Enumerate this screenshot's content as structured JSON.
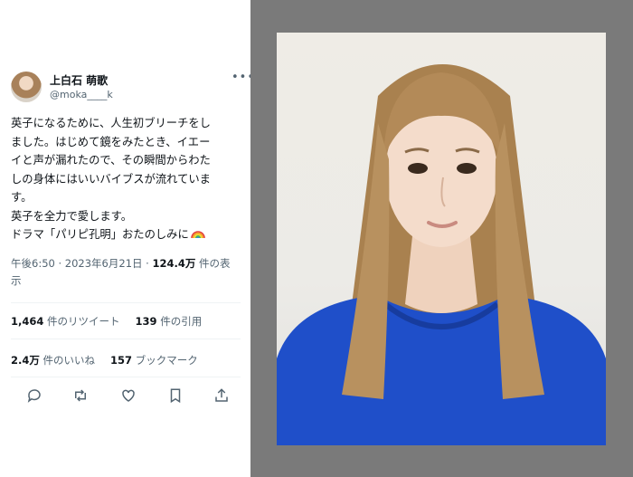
{
  "tweet": {
    "author": {
      "name": "上白石 萌歌",
      "handle": "@moka____k"
    },
    "more_icon": "more-horizontal-icon",
    "body_lines": [
      "英子になるために、人生初ブリーチをし",
      "ました。はじめて鏡をみたとき、イエー",
      "イと声が漏れたので、その瞬間からわた",
      "しの身体にはいいバイブスが流れていま",
      "す。",
      "英子を全力で愛します。"
    ],
    "last_line": "ドラマ「パリピ孔明」おたのしみに",
    "emoji": "rainbow-emoji",
    "timestamp": "午後6:50 · 2023年6月21日 · ",
    "views_count": "124.4万",
    "views_label_1": " 件の表",
    "views_label_2": "示",
    "retweets_count": "1,464",
    "retweets_label": " 件のリツイート",
    "quotes_count": "139",
    "quotes_label": " 件の引用",
    "likes_count": "2.4万",
    "likes_label": " 件のいいね",
    "bookmarks_count": "157",
    "bookmarks_label": " ブックマーク",
    "actions": [
      "reply-icon",
      "retweet-icon",
      "like-icon",
      "bookmark-icon",
      "share-icon"
    ]
  },
  "colors": {
    "text_primary": "#0f1419",
    "text_secondary": "#536471",
    "divider": "#eff3f4",
    "panel_bg": "#7a7a7a",
    "hoodie": "#1f4fc9"
  }
}
